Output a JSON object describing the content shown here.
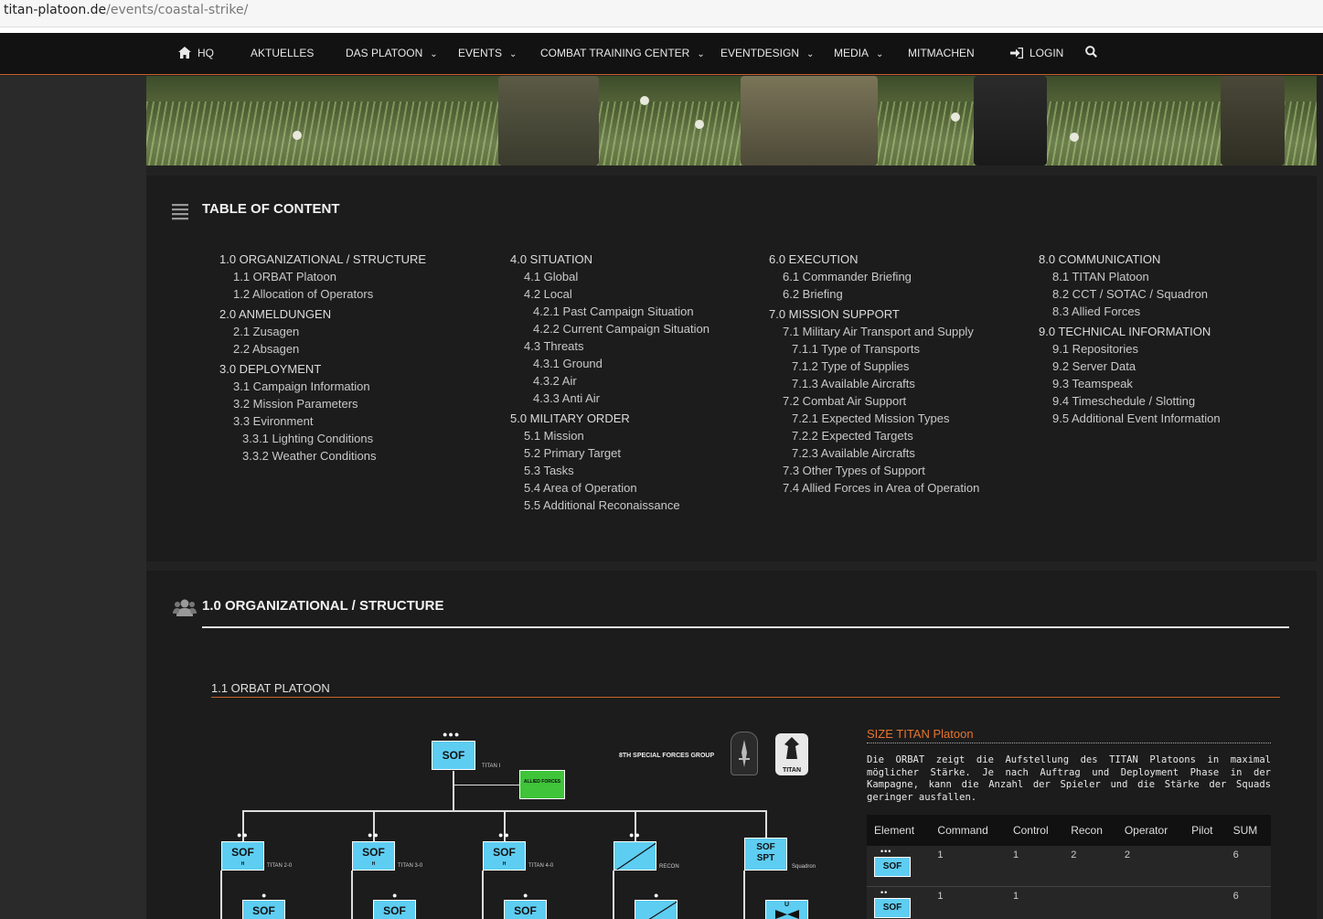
{
  "browser": {
    "url_host": "titan-platoon.de",
    "url_path": "/events/coastal-strike/"
  },
  "nav": {
    "items": [
      {
        "label": "HQ",
        "icon": "home-icon",
        "dropdown": false
      },
      {
        "label": "AKTUELLES",
        "dropdown": false
      },
      {
        "label": "DAS PLATOON",
        "dropdown": true
      },
      {
        "label": "EVENTS",
        "dropdown": true
      },
      {
        "label": "COMBAT TRAINING CENTER",
        "dropdown": true
      },
      {
        "label": "EVENTDESIGN",
        "dropdown": true
      },
      {
        "label": "MEDIA",
        "dropdown": true
      },
      {
        "label": "MITMACHEN",
        "dropdown": false
      },
      {
        "label": "LOGIN",
        "icon": "login-icon",
        "dropdown": false
      }
    ],
    "search_icon": "search-icon",
    "accent": "#c8622a"
  },
  "toc": {
    "title": "TABLE OF CONTENT",
    "columns": [
      [
        {
          "level": 1,
          "text": "1.0 ORGANIZATIONAL / STRUCTURE"
        },
        {
          "level": 2,
          "text": "1.1 ORBAT Platoon"
        },
        {
          "level": 2,
          "text": "1.2 Allocation of Operators"
        },
        {
          "level": 1,
          "text": "2.0 ANMELDUNGEN"
        },
        {
          "level": 2,
          "text": "2.1 Zusagen"
        },
        {
          "level": 2,
          "text": "2.2 Absagen"
        },
        {
          "level": 1,
          "text": "3.0 DEPLOYMENT"
        },
        {
          "level": 2,
          "text": "3.1 Campaign Information"
        },
        {
          "level": 2,
          "text": "3.2 Mission Parameters"
        },
        {
          "level": 2,
          "text": "3.3 Evironment"
        },
        {
          "level": 3,
          "text": "3.3.1 Lighting Conditions"
        },
        {
          "level": 3,
          "text": "3.3.2 Weather Conditions"
        }
      ],
      [
        {
          "level": 1,
          "text": "4.0 SITUATION"
        },
        {
          "level": 2,
          "text": "4.1 Global"
        },
        {
          "level": 2,
          "text": "4.2 Local"
        },
        {
          "level": 3,
          "text": "4.2.1 Past Campaign Situation"
        },
        {
          "level": 3,
          "text": "4.2.2 Current Campaign Situation"
        },
        {
          "level": 2,
          "text": "4.3 Threats"
        },
        {
          "level": 3,
          "text": "4.3.1 Ground"
        },
        {
          "level": 3,
          "text": "4.3.2 Air"
        },
        {
          "level": 3,
          "text": "4.3.3 Anti Air"
        },
        {
          "level": 1,
          "text": "5.0 MILITARY ORDER"
        },
        {
          "level": 2,
          "text": "5.1 Mission"
        },
        {
          "level": 2,
          "text": "5.2 Primary Target"
        },
        {
          "level": 2,
          "text": "5.3 Tasks"
        },
        {
          "level": 2,
          "text": "5.4 Area of Operation"
        },
        {
          "level": 2,
          "text": "5.5 Additional Reconaissance"
        }
      ],
      [
        {
          "level": 1,
          "text": "6.0 EXECUTION"
        },
        {
          "level": 2,
          "text": "6.1 Commander Briefing"
        },
        {
          "level": 2,
          "text": "6.2 Briefing"
        },
        {
          "level": 1,
          "text": "7.0 MISSION SUPPORT"
        },
        {
          "level": 2,
          "text": "7.1 Military Air Transport and Supply"
        },
        {
          "level": 3,
          "text": "7.1.1 Type of Transports"
        },
        {
          "level": 3,
          "text": "7.1.2 Type of Supplies"
        },
        {
          "level": 3,
          "text": "7.1.3 Available Aircrafts"
        },
        {
          "level": 2,
          "text": "7.2 Combat Air Support"
        },
        {
          "level": 3,
          "text": "7.2.1 Expected Mission Types"
        },
        {
          "level": 3,
          "text": "7.2.2 Expected Targets"
        },
        {
          "level": 3,
          "text": "7.2.3 Available Aircrafts"
        },
        {
          "level": 2,
          "text": "7.3 Other Types of Support"
        },
        {
          "level": 2,
          "text": "7.4 Allied Forces in Area of Operation"
        }
      ],
      [
        {
          "level": 1,
          "text": "8.0 COMMUNICATION"
        },
        {
          "level": 2,
          "text": "8.1 TITAN Platoon"
        },
        {
          "level": 2,
          "text": "8.2 CCT / SOTAC / Squadron"
        },
        {
          "level": 2,
          "text": "8.3 Allied Forces"
        },
        {
          "level": 1,
          "text": "9.0 TECHNICAL INFORMATION"
        },
        {
          "level": 2,
          "text": "9.1 Repositories"
        },
        {
          "level": 2,
          "text": "9.2 Server Data"
        },
        {
          "level": 2,
          "text": "9.3 Teamspeak"
        },
        {
          "level": 2,
          "text": "9.4 Timeschedule / Slotting"
        },
        {
          "level": 2,
          "text": "9.5 Additional Event Information"
        }
      ]
    ]
  },
  "org": {
    "title": "1.0 ORGANIZATIONAL / STRUCTURE",
    "subtitle": "1.1 ORBAT PLATOON",
    "diagram": {
      "top_unit": "SOF",
      "top_label": "TITAN I",
      "allied": "ALLIED FORCES",
      "group_label": "8TH SPECIAL FORCES GROUP",
      "logo_text": "TITAN",
      "sof": "SOF",
      "sof_h": "H",
      "titan2": "TITAN 2-0",
      "titan3": "TITAN 3-0",
      "titan4": "TITAN 4-0",
      "recon": "RECON",
      "sofspt": "SOF SPT",
      "squadron": "Squadron",
      "u": "U"
    },
    "size_title": "SIZE TITAN Platoon",
    "size_text": "Die ORBAT zeigt die Aufstellung des TITAN Platoons in maximal möglicher Stärke. Je nach Auftrag und Deployment Phase in der Kampagne, kann die Anzahl der Spieler und die Stärke der Squads geringer ausfallen.",
    "table": {
      "headers": [
        "Element",
        "Command",
        "Control",
        "Recon",
        "Operator",
        "Pilot",
        "SUM"
      ],
      "rows": [
        {
          "element": "SOF",
          "dots": "•••",
          "command": "1",
          "control": "1",
          "recon": "2",
          "operator": "2",
          "pilot": "",
          "sum": "6"
        },
        {
          "element": "SOF",
          "dots": "••",
          "command": "1",
          "control": "1",
          "recon": "",
          "operator": "",
          "pilot": "",
          "sum": "6"
        }
      ]
    }
  }
}
